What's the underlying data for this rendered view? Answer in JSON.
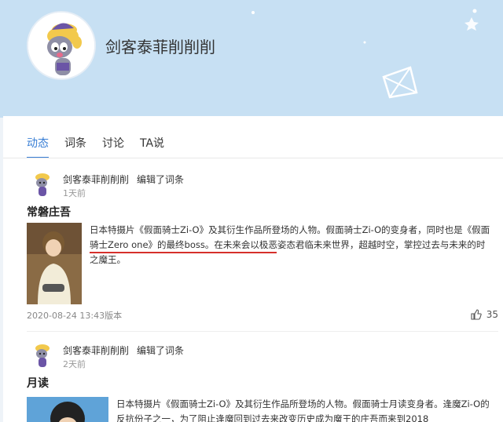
{
  "profile": {
    "name": "剑客泰菲削削削"
  },
  "tabs": [
    {
      "label": "动态"
    },
    {
      "label": "词条"
    },
    {
      "label": "讨论"
    },
    {
      "label": "TA说"
    }
  ],
  "feed": [
    {
      "user": "剑客泰菲削削削",
      "action": "编辑了词条",
      "time": "1天前",
      "title": "常磐庄吾",
      "desc_a": "日本特摄片《假面骑士Zi-O》及其衍生作品所登场的人物。假面骑士Zi-O的变身者，同时也是",
      "desc_b": "《假面骑士Zero one》的最终boss。",
      "desc_c": "在未来会以极恶姿态君临未来世界，超越时空，掌控过去与未来的时之魔王。",
      "version_time": "2020-08-24 13:43版本",
      "likes": "35"
    },
    {
      "user": "剑客泰菲削削削",
      "action": "编辑了词条",
      "time": "2天前",
      "title": "月读",
      "desc_a": "日本特摄片《假面骑士Zi-O》及其衍生作品所登场的人物。假面骑士月读变身者。",
      "desc_b": "逢魔Zi-O的反抗份子之一，为了阻止逢魔回到过去来改变历史成为魔王的庄吾而来到2018"
    }
  ],
  "colors": {
    "accent": "#3a7fd5",
    "banner": "#c7e0f3",
    "underline": "#d6302b"
  }
}
